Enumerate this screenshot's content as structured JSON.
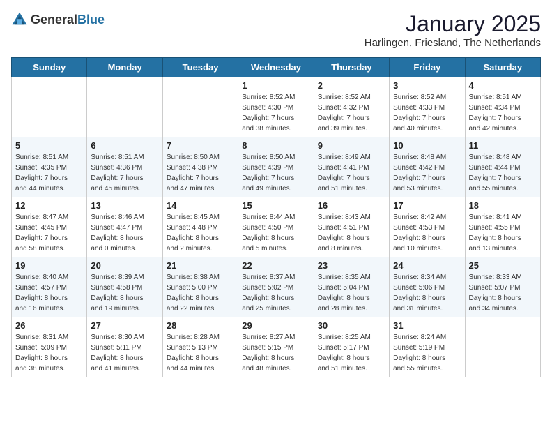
{
  "logo": {
    "text_general": "General",
    "text_blue": "Blue"
  },
  "title": "January 2025",
  "subtitle": "Harlingen, Friesland, The Netherlands",
  "days_of_week": [
    "Sunday",
    "Monday",
    "Tuesday",
    "Wednesday",
    "Thursday",
    "Friday",
    "Saturday"
  ],
  "weeks": [
    [
      {
        "day": "",
        "info": ""
      },
      {
        "day": "",
        "info": ""
      },
      {
        "day": "",
        "info": ""
      },
      {
        "day": "1",
        "info": "Sunrise: 8:52 AM\nSunset: 4:30 PM\nDaylight: 7 hours\nand 38 minutes."
      },
      {
        "day": "2",
        "info": "Sunrise: 8:52 AM\nSunset: 4:32 PM\nDaylight: 7 hours\nand 39 minutes."
      },
      {
        "day": "3",
        "info": "Sunrise: 8:52 AM\nSunset: 4:33 PM\nDaylight: 7 hours\nand 40 minutes."
      },
      {
        "day": "4",
        "info": "Sunrise: 8:51 AM\nSunset: 4:34 PM\nDaylight: 7 hours\nand 42 minutes."
      }
    ],
    [
      {
        "day": "5",
        "info": "Sunrise: 8:51 AM\nSunset: 4:35 PM\nDaylight: 7 hours\nand 44 minutes."
      },
      {
        "day": "6",
        "info": "Sunrise: 8:51 AM\nSunset: 4:36 PM\nDaylight: 7 hours\nand 45 minutes."
      },
      {
        "day": "7",
        "info": "Sunrise: 8:50 AM\nSunset: 4:38 PM\nDaylight: 7 hours\nand 47 minutes."
      },
      {
        "day": "8",
        "info": "Sunrise: 8:50 AM\nSunset: 4:39 PM\nDaylight: 7 hours\nand 49 minutes."
      },
      {
        "day": "9",
        "info": "Sunrise: 8:49 AM\nSunset: 4:41 PM\nDaylight: 7 hours\nand 51 minutes."
      },
      {
        "day": "10",
        "info": "Sunrise: 8:48 AM\nSunset: 4:42 PM\nDaylight: 7 hours\nand 53 minutes."
      },
      {
        "day": "11",
        "info": "Sunrise: 8:48 AM\nSunset: 4:44 PM\nDaylight: 7 hours\nand 55 minutes."
      }
    ],
    [
      {
        "day": "12",
        "info": "Sunrise: 8:47 AM\nSunset: 4:45 PM\nDaylight: 7 hours\nand 58 minutes."
      },
      {
        "day": "13",
        "info": "Sunrise: 8:46 AM\nSunset: 4:47 PM\nDaylight: 8 hours\nand 0 minutes."
      },
      {
        "day": "14",
        "info": "Sunrise: 8:45 AM\nSunset: 4:48 PM\nDaylight: 8 hours\nand 2 minutes."
      },
      {
        "day": "15",
        "info": "Sunrise: 8:44 AM\nSunset: 4:50 PM\nDaylight: 8 hours\nand 5 minutes."
      },
      {
        "day": "16",
        "info": "Sunrise: 8:43 AM\nSunset: 4:51 PM\nDaylight: 8 hours\nand 8 minutes."
      },
      {
        "day": "17",
        "info": "Sunrise: 8:42 AM\nSunset: 4:53 PM\nDaylight: 8 hours\nand 10 minutes."
      },
      {
        "day": "18",
        "info": "Sunrise: 8:41 AM\nSunset: 4:55 PM\nDaylight: 8 hours\nand 13 minutes."
      }
    ],
    [
      {
        "day": "19",
        "info": "Sunrise: 8:40 AM\nSunset: 4:57 PM\nDaylight: 8 hours\nand 16 minutes."
      },
      {
        "day": "20",
        "info": "Sunrise: 8:39 AM\nSunset: 4:58 PM\nDaylight: 8 hours\nand 19 minutes."
      },
      {
        "day": "21",
        "info": "Sunrise: 8:38 AM\nSunset: 5:00 PM\nDaylight: 8 hours\nand 22 minutes."
      },
      {
        "day": "22",
        "info": "Sunrise: 8:37 AM\nSunset: 5:02 PM\nDaylight: 8 hours\nand 25 minutes."
      },
      {
        "day": "23",
        "info": "Sunrise: 8:35 AM\nSunset: 5:04 PM\nDaylight: 8 hours\nand 28 minutes."
      },
      {
        "day": "24",
        "info": "Sunrise: 8:34 AM\nSunset: 5:06 PM\nDaylight: 8 hours\nand 31 minutes."
      },
      {
        "day": "25",
        "info": "Sunrise: 8:33 AM\nSunset: 5:07 PM\nDaylight: 8 hours\nand 34 minutes."
      }
    ],
    [
      {
        "day": "26",
        "info": "Sunrise: 8:31 AM\nSunset: 5:09 PM\nDaylight: 8 hours\nand 38 minutes."
      },
      {
        "day": "27",
        "info": "Sunrise: 8:30 AM\nSunset: 5:11 PM\nDaylight: 8 hours\nand 41 minutes."
      },
      {
        "day": "28",
        "info": "Sunrise: 8:28 AM\nSunset: 5:13 PM\nDaylight: 8 hours\nand 44 minutes."
      },
      {
        "day": "29",
        "info": "Sunrise: 8:27 AM\nSunset: 5:15 PM\nDaylight: 8 hours\nand 48 minutes."
      },
      {
        "day": "30",
        "info": "Sunrise: 8:25 AM\nSunset: 5:17 PM\nDaylight: 8 hours\nand 51 minutes."
      },
      {
        "day": "31",
        "info": "Sunrise: 8:24 AM\nSunset: 5:19 PM\nDaylight: 8 hours\nand 55 minutes."
      },
      {
        "day": "",
        "info": ""
      }
    ]
  ]
}
